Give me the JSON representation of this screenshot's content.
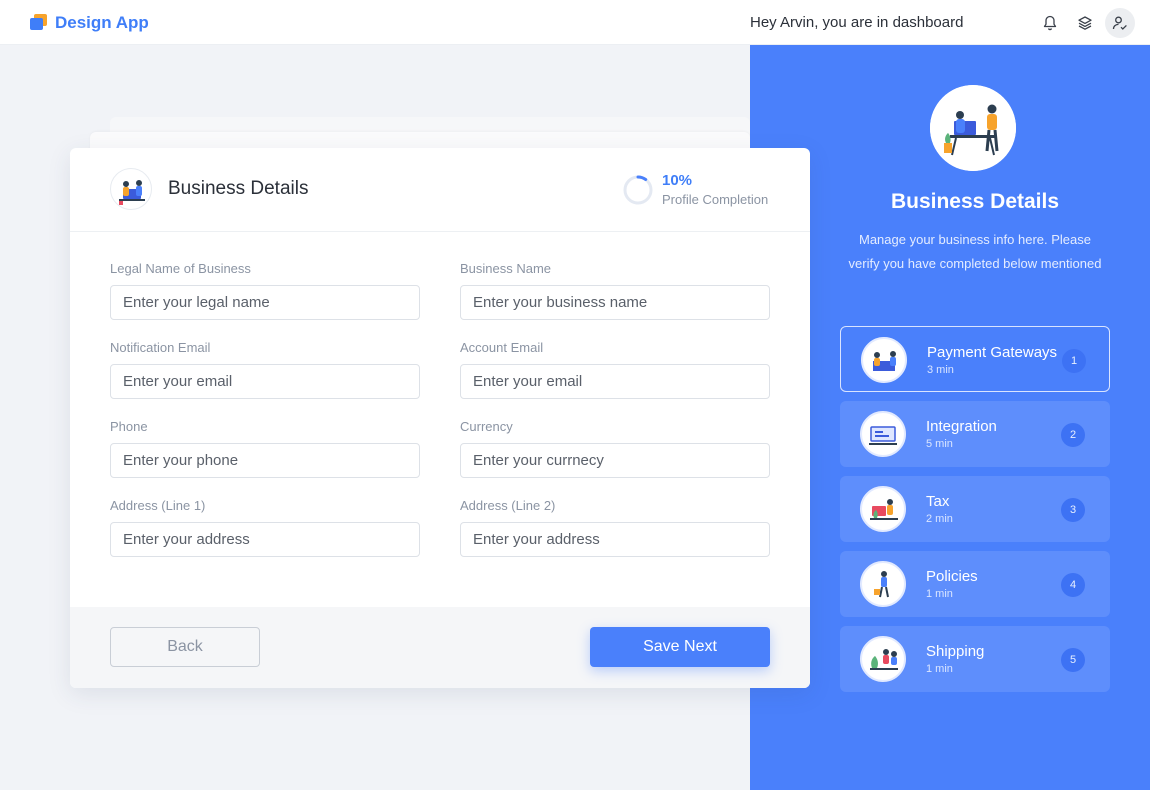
{
  "app": {
    "name": "Design App"
  },
  "header": {
    "greeting": "Hey Arvin, you are in dashboard",
    "icons": [
      "bell-icon",
      "layers-icon",
      "user-check-icon"
    ]
  },
  "card": {
    "title": "Business Details",
    "progress": {
      "value": 0.1,
      "label_value": "10%",
      "label": "Profile Completion"
    },
    "fields": [
      {
        "label": "Legal Name of Business",
        "placeholder": "Enter your legal name"
      },
      {
        "label": "Business Name",
        "placeholder": "Enter your business name"
      },
      {
        "label": "Notification Email",
        "placeholder": "Enter your email"
      },
      {
        "label": "Account Email",
        "placeholder": "Enter your email"
      },
      {
        "label": "Phone",
        "placeholder": "Enter your phone"
      },
      {
        "label": "Currency",
        "placeholder": "Enter your currnecy"
      },
      {
        "label": "Address (Line 1)",
        "placeholder": "Enter your address"
      },
      {
        "label": "Address (Line 2)",
        "placeholder": "Enter your address"
      }
    ],
    "back_label": "Back",
    "save_label": "Save Next"
  },
  "panel": {
    "title": "Business Details",
    "description": "Manage your business info here. Please verify you have completed below mentioned",
    "steps": [
      {
        "name": "Payment Gateways",
        "time": "3 min",
        "number": "1",
        "active": true
      },
      {
        "name": "Integration",
        "time": "5 min",
        "number": "2",
        "active": false
      },
      {
        "name": "Tax",
        "time": "2 min",
        "number": "3",
        "active": false
      },
      {
        "name": "Policies",
        "time": "1 min",
        "number": "4",
        "active": false
      },
      {
        "name": "Shipping",
        "time": "1 min",
        "number": "5",
        "active": false
      }
    ]
  },
  "colors": {
    "accent": "#4a80fb",
    "brand": "#3f7ef8",
    "brand_secondary": "#f7a32c"
  }
}
